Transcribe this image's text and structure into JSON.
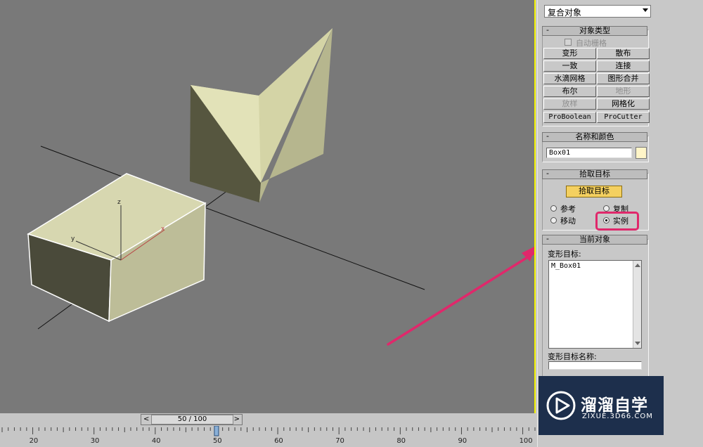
{
  "command_panel": {
    "category_dropdown": "复合对象",
    "object_type": {
      "title": "对象类型",
      "autogrid_label": "自动栅格",
      "buttons": [
        "变形",
        "散布",
        "一致",
        "连接",
        "水滴网格",
        "图形合并",
        "布尔",
        "地形",
        "放样",
        "网格化",
        "ProBoolean",
        "ProCutter"
      ]
    },
    "name_and_color": {
      "title": "名称和颜色",
      "name_value": "Box01",
      "color": "#fff5c8"
    },
    "pick_targets": {
      "title": "拾取目标",
      "pick_button": "拾取目标",
      "options": [
        "参考",
        "复制",
        "移动",
        "实例"
      ],
      "selected": "实例"
    },
    "current_object": {
      "title": "当前对象",
      "morph_targets_label": "变形目标:",
      "targets": [
        "M_Box01"
      ],
      "target_name_label": "变形目标名称:",
      "target_name_value": ""
    }
  },
  "timeline": {
    "frame_display": "50 / 100",
    "current_frame": 50,
    "ticks": [
      "20",
      "30",
      "40",
      "50",
      "60",
      "70",
      "80",
      "90",
      "100"
    ]
  },
  "watermark": {
    "brand": "溜溜自学",
    "url": "ZIXUE.3D66.COM"
  },
  "colors": {
    "viewport_border": "#f2f200",
    "highlight_box": "#e0286b",
    "annotation_arrow": "#e0286b",
    "pick_button_active": "#f4d060"
  },
  "axis_labels": {
    "z": "z",
    "y": "y",
    "x": "x"
  }
}
